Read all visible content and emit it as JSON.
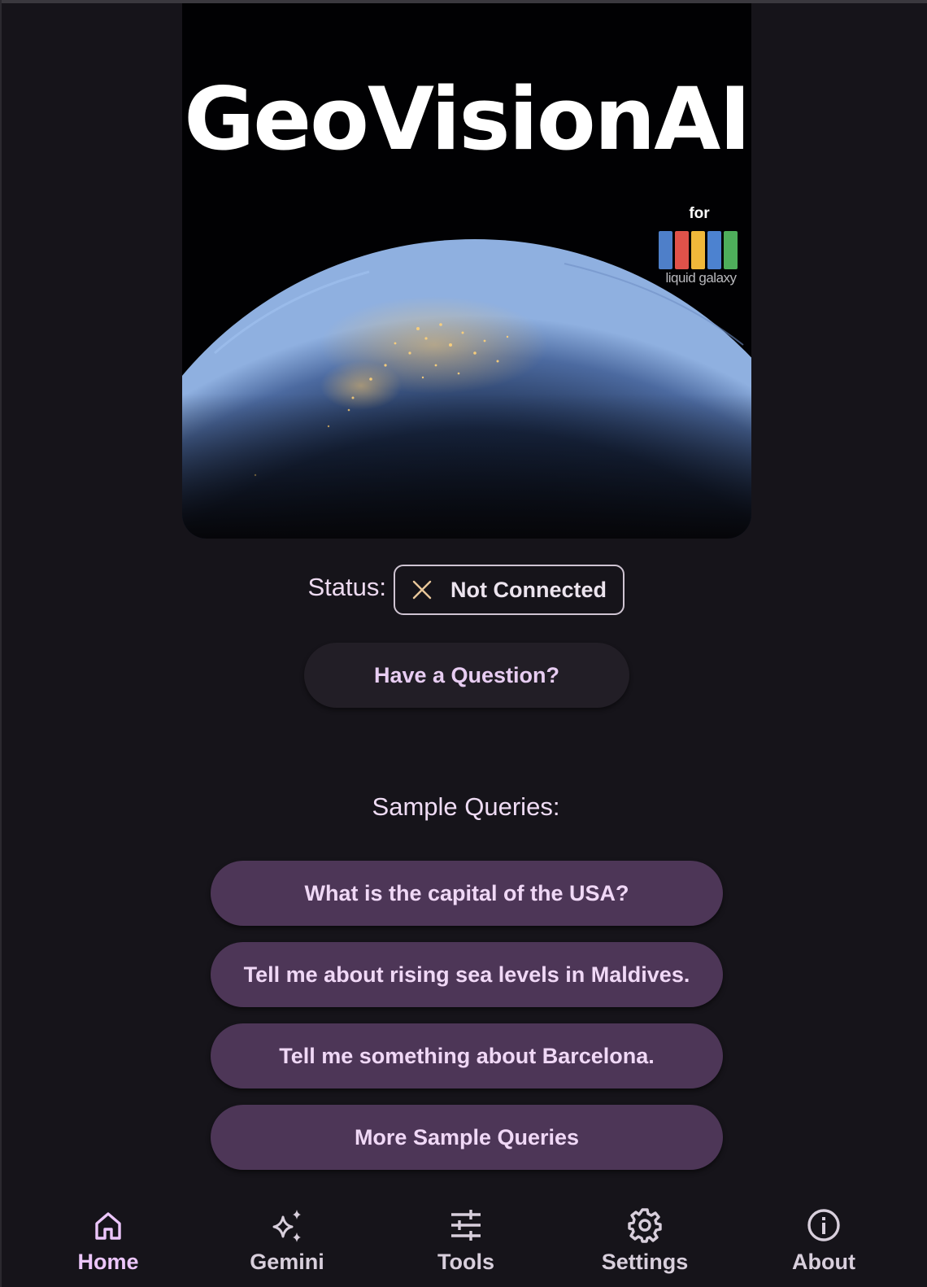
{
  "hero": {
    "title": "GeoVisionAI",
    "logo_for": "for",
    "logo_name": "liquid galaxy",
    "logo_bar_colors": [
      "#4e7fc9",
      "#e0524a",
      "#f0b83a",
      "#4c82d0",
      "#4eae5b"
    ]
  },
  "status": {
    "label": "Status:",
    "value": "Not Connected",
    "icon": "close-icon"
  },
  "question_button": {
    "label": "Have a Question?"
  },
  "sample_queries": {
    "heading": "Sample Queries:",
    "items": [
      "What is the capital of the USA?",
      "Tell me about rising sea levels in Maldives.",
      "Tell me something about Barcelona.",
      "More Sample Queries"
    ]
  },
  "nav": {
    "items": [
      {
        "label": "Home",
        "icon": "home-icon",
        "active": true
      },
      {
        "label": "Gemini",
        "icon": "sparkle-icon",
        "active": false
      },
      {
        "label": "Tools",
        "icon": "tune-icon",
        "active": false
      },
      {
        "label": "Settings",
        "icon": "gear-icon",
        "active": false
      },
      {
        "label": "About",
        "icon": "info-icon",
        "active": false
      }
    ]
  },
  "colors": {
    "background": "#16141a",
    "query_button": "#4d3657",
    "accent_text": "#ecc6fb",
    "status_x": "#e9c79a"
  }
}
